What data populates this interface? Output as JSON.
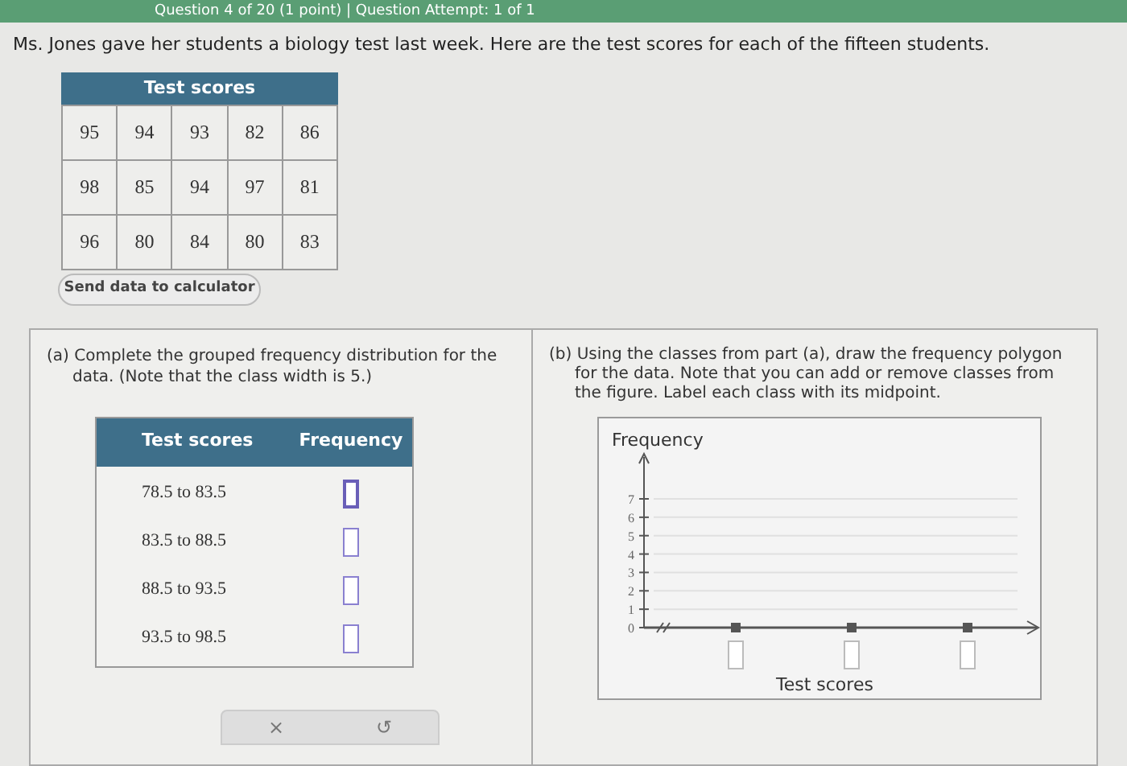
{
  "header": {
    "text": "Question 4 of 20 (1 point)  |  Question Attempt: 1 of 1"
  },
  "intro": "Ms. Jones gave her students a biology test last week. Here are the test scores for each of the fifteen students.",
  "scores_table": {
    "title": "Test scores",
    "rows": [
      [
        "95",
        "94",
        "93",
        "82",
        "86"
      ],
      [
        "98",
        "85",
        "94",
        "97",
        "81"
      ],
      [
        "96",
        "80",
        "84",
        "80",
        "83"
      ]
    ]
  },
  "send_button": "Send data to calculator",
  "part_a": {
    "prompt": "(a) Complete the grouped frequency distribution for the data. (Note that the class width is 5.)",
    "columns": [
      "Test scores",
      "Frequency"
    ],
    "rows": [
      {
        "class": "78.5 to 83.5",
        "focused": true
      },
      {
        "class": "83.5 to 88.5",
        "focused": false
      },
      {
        "class": "88.5 to 93.5",
        "focused": false
      },
      {
        "class": "93.5 to 98.5",
        "focused": false
      }
    ],
    "toolbar": [
      "×",
      "↺"
    ]
  },
  "part_b": {
    "prompt": "(b) Using the classes from part (a), draw the frequency polygon for the data. Note that you can add or remove classes from the figure. Label each class with its midpoint.",
    "graph": {
      "y_title": "Frequency",
      "x_title": "Test scores",
      "y_tick_labels": [
        "7",
        "6",
        "5",
        "4",
        "3",
        "2",
        "1",
        "0"
      ]
    }
  }
}
